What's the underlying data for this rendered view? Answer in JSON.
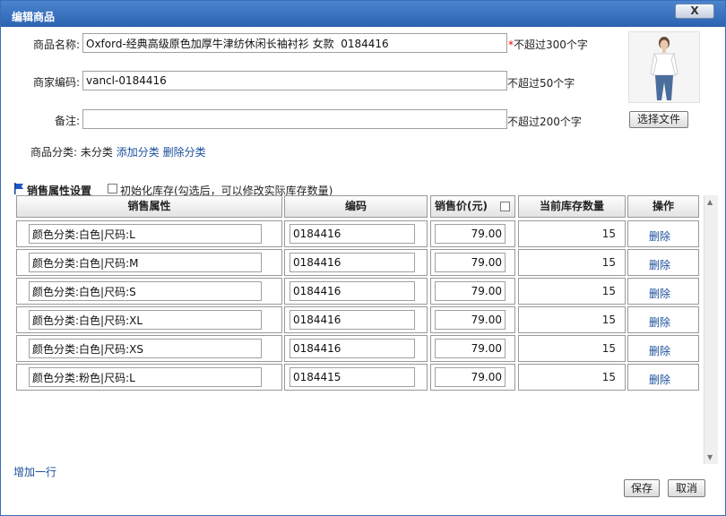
{
  "window": {
    "title": "编辑商品",
    "close_label": "X"
  },
  "form": {
    "name_label": "商品名称:",
    "name_value": "Oxford-经典高级原色加厚牛津纺休闲长袖衬衫 女款  0184416",
    "name_required": "*",
    "name_hint": "不超过300个字",
    "code_label": "商家编码:",
    "code_value": "vancl-0184416",
    "code_hint": "不超过50个字",
    "note_label": "备注:",
    "note_value": "",
    "note_hint": "不超过200个字",
    "category_label": "商品分类:",
    "category_value": "未分类",
    "add_category": "添加分类",
    "delete_category": "删除分类",
    "file_button": "选择文件"
  },
  "sales": {
    "section_title": "销售属性设置",
    "init_stock_label": "初始化库存(勾选后，可以修改实际库存数量)",
    "columns": [
      "销售属性",
      "编码",
      "销售价(元)",
      "当前库存数量",
      "操作"
    ],
    "rows": [
      {
        "attr": "颜色分类:白色|尺码:L",
        "code": "0184416",
        "price": "79.00",
        "stock": "15",
        "action": "删除"
      },
      {
        "attr": "颜色分类:白色|尺码:M",
        "code": "0184416",
        "price": "79.00",
        "stock": "15",
        "action": "删除"
      },
      {
        "attr": "颜色分类:白色|尺码:S",
        "code": "0184416",
        "price": "79.00",
        "stock": "15",
        "action": "删除"
      },
      {
        "attr": "颜色分类:白色|尺码:XL",
        "code": "0184416",
        "price": "79.00",
        "stock": "15",
        "action": "删除"
      },
      {
        "attr": "颜色分类:白色|尺码:XS",
        "code": "0184416",
        "price": "79.00",
        "stock": "15",
        "action": "删除"
      },
      {
        "attr": "颜色分类:粉色|尺码:L",
        "code": "0184415",
        "price": "79.00",
        "stock": "15",
        "action": "删除"
      }
    ],
    "add_row": "增加一行"
  },
  "footer": {
    "save": "保存",
    "cancel": "取消"
  },
  "colors": {
    "title_bar": "#2b63b2",
    "link": "#1a4e9b",
    "required": "#e00000"
  }
}
